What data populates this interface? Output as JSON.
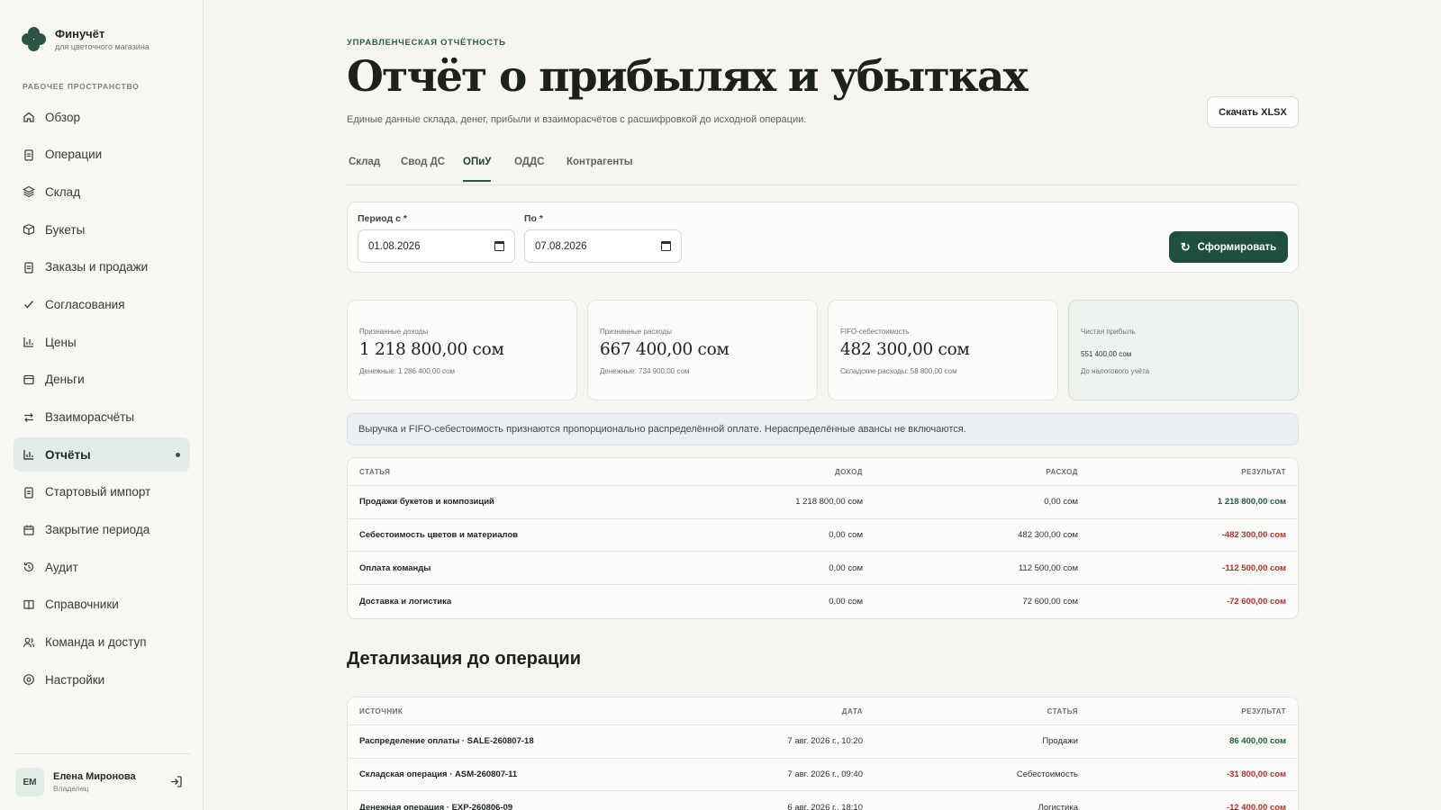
{
  "brand": {
    "name": "Финучёт",
    "subtitle": "для цветочного магазина"
  },
  "sidebar": {
    "section_label": "РАБОЧЕЕ ПРОСТРАНСТВО",
    "items": [
      {
        "label": "Обзор",
        "icon": "home-icon"
      },
      {
        "label": "Операции",
        "icon": "clipboard-icon"
      },
      {
        "label": "Склад",
        "icon": "layers-icon"
      },
      {
        "label": "Букеты",
        "icon": "box-icon"
      },
      {
        "label": "Заказы и продажи",
        "icon": "clipboard-icon"
      },
      {
        "label": "Согласования",
        "icon": "check-icon"
      },
      {
        "label": "Цены",
        "icon": "bar-chart-icon"
      },
      {
        "label": "Деньги",
        "icon": "wallet-icon"
      },
      {
        "label": "Взаиморасчёты",
        "icon": "arrows-icon"
      },
      {
        "label": "Отчёты",
        "icon": "bar-chart-icon",
        "active": true
      },
      {
        "label": "Стартовый импорт",
        "icon": "clipboard-icon"
      },
      {
        "label": "Закрытие периода",
        "icon": "calendar-icon"
      },
      {
        "label": "Аудит",
        "icon": "history-icon"
      },
      {
        "label": "Справочники",
        "icon": "book-icon"
      },
      {
        "label": "Команда и доступ",
        "icon": "users-icon"
      },
      {
        "label": "Настройки",
        "icon": "gear-icon"
      }
    ]
  },
  "user": {
    "initials": "ЕМ",
    "name": "Елена Миронова",
    "role": "Владелец"
  },
  "header": {
    "eyebrow": "УПРАВЛЕНЧЕСКАЯ ОТЧЁТНОСТЬ",
    "title": "Отчёт о прибылях и убытках",
    "subtitle": "Единые данные склада, денег, прибыли и взаиморасчётов с расшифровкой до исходной операции.",
    "download_label": "Скачать XLSX"
  },
  "tabs": [
    {
      "label": "Склад"
    },
    {
      "label": "Свод ДС"
    },
    {
      "label": "ОПиУ",
      "active": true
    },
    {
      "label": "ОДДС"
    },
    {
      "label": "Контрагенты"
    }
  ],
  "filter": {
    "from_label": "Период с *",
    "from_value": "01.08.2026",
    "to_label": "По *",
    "to_value": "07.08.2026",
    "generate_label": "Сформировать"
  },
  "kpis": [
    {
      "label": "Признанные доходы",
      "value": "1 218 800,00 сом",
      "note": "Денежные: 1 286 400,00 сом"
    },
    {
      "label": "Признанные расходы",
      "value": "667 400,00 сом",
      "note": "Денежные: 734 900,00 сом"
    },
    {
      "label": "FIFO-себестоимость",
      "value": "482 300,00 сом",
      "note": "Складские расходы: 58 800,00 сом"
    },
    {
      "label": "Чистая прибыль",
      "value": "551 400,00 сом",
      "note": "До налогового учёта"
    }
  ],
  "banner": "Выручка и FIFO-себестоимость признаются пропорционально распределённой оплате. Нераспределённые авансы не включаются.",
  "pnl_table": {
    "headers": [
      "СТАТЬЯ",
      "ДОХОД",
      "РАСХОД",
      "РЕЗУЛЬТАТ"
    ],
    "rows": [
      {
        "item": "Продажи букетов и композиций",
        "income": "1 218 800,00 сом",
        "expense": "0,00 сом",
        "result": "1 218 800,00 сом",
        "sign": "pos"
      },
      {
        "item": "Себестоимость цветов и материалов",
        "income": "0,00 сом",
        "expense": "482 300,00 сом",
        "result": "-482 300,00 сом",
        "sign": "neg"
      },
      {
        "item": "Оплата команды",
        "income": "0,00 сом",
        "expense": "112 500,00 сом",
        "result": "-112 500,00 сом",
        "sign": "neg"
      },
      {
        "item": "Доставка и логистика",
        "income": "0,00 сом",
        "expense": "72 600,00 сом",
        "result": "-72 600,00 сом",
        "sign": "neg"
      }
    ]
  },
  "detail": {
    "title": "Детализация до операции",
    "headers": [
      "ИСТОЧНИК",
      "ДАТА",
      "СТАТЬЯ",
      "РЕЗУЛЬТАТ"
    ],
    "rows": [
      {
        "source": "Распределение оплаты · SALE-260807-18",
        "date": "7 авг. 2026 г., 10:20",
        "item": "Продажи",
        "result": "86 400,00 сом",
        "sign": "pos"
      },
      {
        "source": "Складская операция · ASM-260807-11",
        "date": "7 авг. 2026 г., 09:40",
        "item": "Себестоимость",
        "result": "-31 800,00 сом",
        "sign": "neg"
      },
      {
        "source": "Денежная операция · EXP-260806-09",
        "date": "6 авг. 2026 г., 18:10",
        "item": "Логистика",
        "result": "-12 400,00 сом",
        "sign": "neg"
      }
    ]
  }
}
